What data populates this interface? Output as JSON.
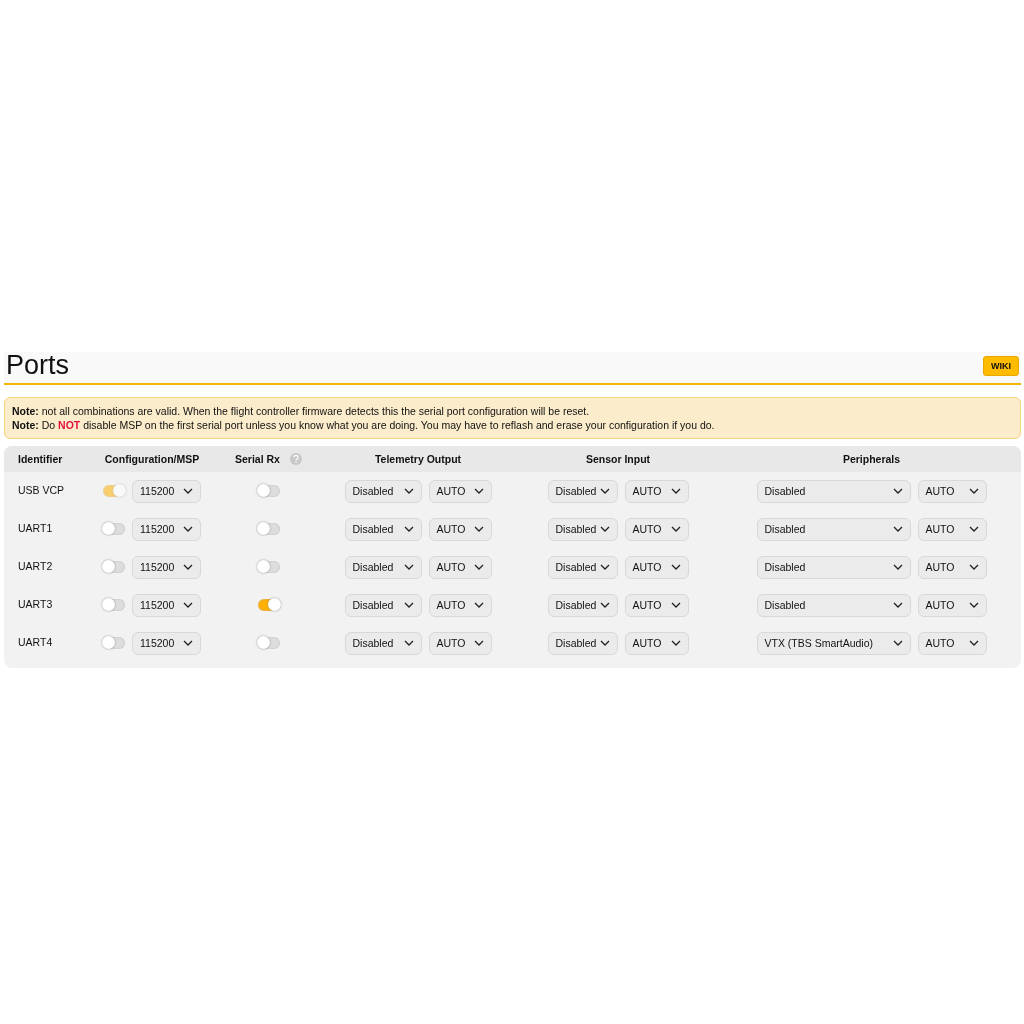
{
  "title": "Ports",
  "wiki_button": "WIKI",
  "notes": [
    {
      "label": "Note:",
      "segments": [
        {
          "kind": "plain",
          "text": "not all combinations are valid. When the flight controller firmware detects this the serial port configuration will be reset."
        }
      ]
    },
    {
      "label": "Note:",
      "segments": [
        {
          "kind": "plain",
          "text": "Do "
        },
        {
          "kind": "warning",
          "text": "NOT"
        },
        {
          "kind": "plain",
          "text": " disable MSP on the first serial port unless you know what you are doing. You may have to reflash and erase your configuration if you do."
        }
      ]
    }
  ],
  "columns": [
    {
      "label": "Identifier",
      "kind": "plain"
    },
    {
      "label": "Configuration/MSP",
      "kind": "plain"
    },
    {
      "label": "Serial Rx",
      "kind": "help"
    },
    {
      "label": "Telemetry Output",
      "kind": "plain"
    },
    {
      "label": "Sensor Input",
      "kind": "plain"
    },
    {
      "label": "Peripherals",
      "kind": "plain"
    }
  ],
  "rows": [
    {
      "identifier": "USB VCP",
      "msp": {
        "on": true,
        "disabled": true
      },
      "msp_baud": "115200",
      "serial_rx": {
        "on": false
      },
      "telemetry": {
        "value": "Disabled",
        "baud": "AUTO"
      },
      "sensor": {
        "value": "Disabled",
        "baud": "AUTO"
      },
      "peripherals": {
        "value": "Disabled",
        "baud": "AUTO"
      }
    },
    {
      "identifier": "UART1",
      "msp": {
        "on": false,
        "disabled": false
      },
      "msp_baud": "115200",
      "serial_rx": {
        "on": false
      },
      "telemetry": {
        "value": "Disabled",
        "baud": "AUTO"
      },
      "sensor": {
        "value": "Disabled",
        "baud": "AUTO"
      },
      "peripherals": {
        "value": "Disabled",
        "baud": "AUTO"
      }
    },
    {
      "identifier": "UART2",
      "msp": {
        "on": false,
        "disabled": false
      },
      "msp_baud": "115200",
      "serial_rx": {
        "on": false
      },
      "telemetry": {
        "value": "Disabled",
        "baud": "AUTO"
      },
      "sensor": {
        "value": "Disabled",
        "baud": "AUTO"
      },
      "peripherals": {
        "value": "Disabled",
        "baud": "AUTO"
      }
    },
    {
      "identifier": "UART3",
      "msp": {
        "on": false,
        "disabled": false
      },
      "msp_baud": "115200",
      "serial_rx": {
        "on": true
      },
      "telemetry": {
        "value": "Disabled",
        "baud": "AUTO"
      },
      "sensor": {
        "value": "Disabled",
        "baud": "AUTO"
      },
      "peripherals": {
        "value": "Disabled",
        "baud": "AUTO"
      }
    },
    {
      "identifier": "UART4",
      "msp": {
        "on": false,
        "disabled": false
      },
      "msp_baud": "115200",
      "serial_rx": {
        "on": false
      },
      "telemetry": {
        "value": "Disabled",
        "baud": "AUTO"
      },
      "sensor": {
        "value": "Disabled",
        "baud": "AUTO"
      },
      "peripherals": {
        "value": "VTX (TBS SmartAudio)",
        "baud": "AUTO"
      }
    }
  ]
}
